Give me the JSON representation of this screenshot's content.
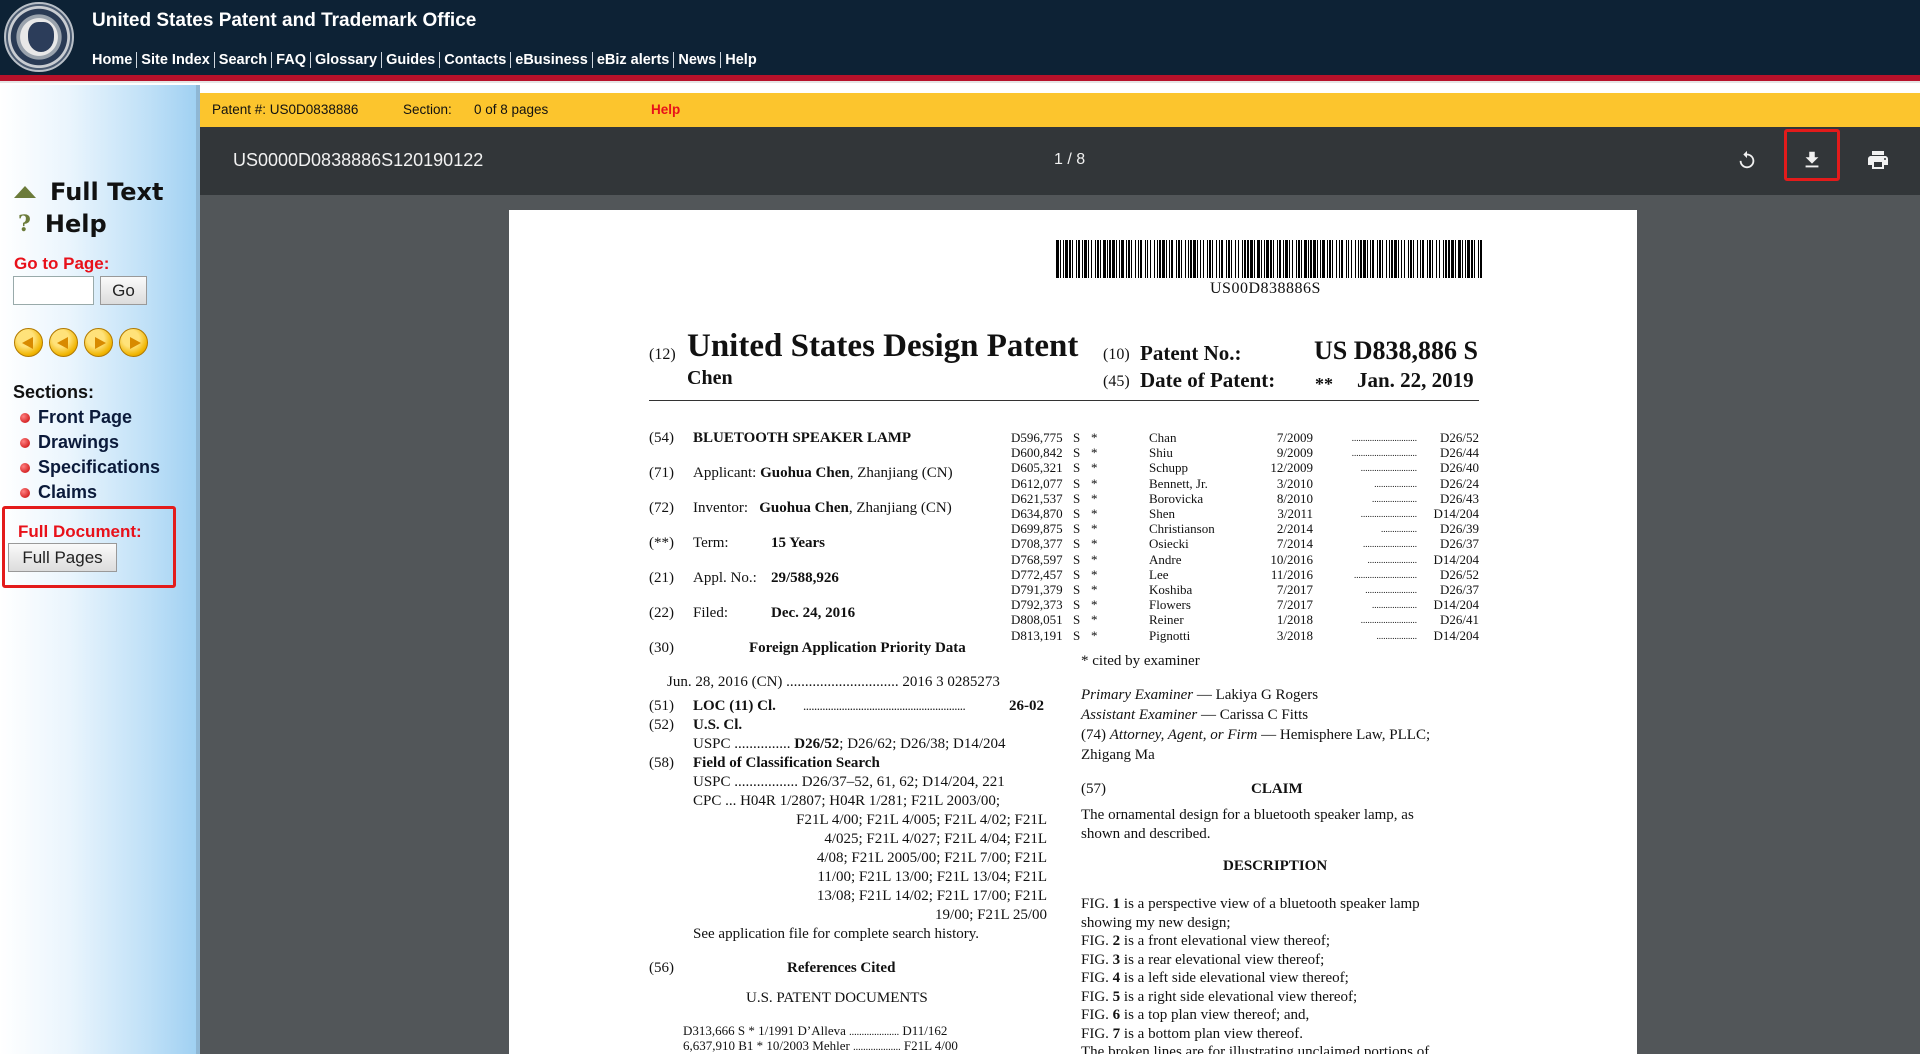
{
  "header": {
    "site_title": "United States Patent and Trademark Office",
    "nav": [
      "Home",
      "Site Index",
      "Search",
      "FAQ",
      "Glossary",
      "Guides",
      "Contacts",
      "eBusiness",
      "eBiz alerts",
      "News",
      "Help"
    ]
  },
  "sidebar": {
    "full_text": "Full Text",
    "help": "Help",
    "go_to_page_label": "Go to Page:",
    "go_to_page_value": "",
    "go_button": "Go",
    "sections_label": "Sections:",
    "sections": [
      "Front Page",
      "Drawings",
      "Specifications",
      "Claims"
    ],
    "full_document_label": "Full Document:",
    "full_pages_button": "Full Pages"
  },
  "infobar": {
    "patent_label": "Patent #: US0D0838886",
    "section_label": "Section:",
    "section_value": "0 of 8 pages",
    "help": "Help"
  },
  "viewer": {
    "doc_title": "US0000D0838886S120190122",
    "page_counter": "1 / 8",
    "icons": [
      "rotate-icon",
      "download-icon",
      "print-icon"
    ]
  },
  "document": {
    "barcode_text": "US00D838886S",
    "h12": "(12)",
    "main_title": "United States Design Patent",
    "inventor_surname": "Chen",
    "h10": "(10)",
    "patent_no_label": "Patent No.:",
    "patent_no": "US D838,886 S",
    "h45": "(45)",
    "date_label": "Date of Patent:",
    "date_stars": "**",
    "date": "Jan. 22, 2019",
    "left": {
      "f54_num": "(54)",
      "f54": "BLUETOOTH SPEAKER LAMP",
      "f71_num": "(71)",
      "f71_label": "Applicant:",
      "f71_name": "Guohua Chen",
      "f71_loc": ", Zhanjiang (CN)",
      "f72_num": "(72)",
      "f72_label": "Inventor:",
      "f72_name": "Guohua Chen",
      "f72_loc": ", Zhanjiang (CN)",
      "fterm_num": "(**)",
      "fterm_label": "Term:",
      "fterm_value": "15 Years",
      "f21_num": "(21)",
      "f21_label": "Appl. No.:",
      "f21_value": "29/588,926",
      "f22_num": "(22)",
      "f22_label": "Filed:",
      "f22_value": "Dec. 24, 2016",
      "f30_num": "(30)",
      "f30_title": "Foreign Application Priority Data",
      "f30_row": "Jun. 28, 2016    (CN) .............................. 2016 3 0285273",
      "f51_num": "(51)",
      "f51_label": "LOC (11) Cl.",
      "f51_dots": "...........................................................",
      "f51_value": "26-02",
      "f52_num": "(52)",
      "f52_label": "U.S. Cl.",
      "f52_row_a": "USPC ...............",
      "f52_row_b": "D26/52",
      "f52_row_c": "; D26/62; D26/38; D14/204",
      "f58_num": "(58)",
      "f58_title": "Field of Classification Search",
      "f58_lines": [
        "USPC ................. D26/37–52, 61, 62; D14/204, 221",
        "CPC ... H04R 1/2807; H04R 1/281; F21L 2003/00;",
        "F21L 4/00; F21L 4/005; F21L 4/02; F21L",
        "4/025; F21L 4/027; F21L 4/04; F21L",
        "4/08; F21L 2005/00; F21L 7/00; F21L",
        "11/00; F21L 13/00; F21L 13/04; F21L",
        "13/08; F21L 14/02; F21L 17/00; F21L",
        "19/00; F21L 25/00"
      ],
      "f58_note": "See application file for complete search history.",
      "f56_num": "(56)",
      "f56_title": "References Cited",
      "f56_subtitle": "U.S. PATENT DOCUMENTS",
      "refs": [
        [
          "D313,666",
          "S",
          "*",
          "1/1991",
          "D’Alleva",
          "....................",
          "D11/162"
        ],
        [
          "6,637,910",
          "B1",
          "*",
          "10/2003",
          "Mehler",
          "...................",
          "F21L 4/00"
        ]
      ]
    },
    "right": {
      "refs": [
        [
          "D596,775",
          "S",
          "*",
          "7/2009",
          "Chan",
          ".............................",
          "D26/52"
        ],
        [
          "D600,842",
          "S",
          "*",
          "9/2009",
          "Shiu",
          ".............................",
          "D26/44"
        ],
        [
          "D605,321",
          "S",
          "*",
          "12/2009",
          "Schupp",
          ".........................",
          "D26/40"
        ],
        [
          "D612,077",
          "S",
          "*",
          "3/2010",
          "Bennett, Jr.",
          "...................",
          "D26/24"
        ],
        [
          "D621,537",
          "S",
          "*",
          "8/2010",
          "Borovicka",
          "....................",
          "D26/43"
        ],
        [
          "D634,870",
          "S",
          "*",
          "3/2011",
          "Shen",
          ".........................",
          "D14/204"
        ],
        [
          "D699,875",
          "S",
          "*",
          "2/2014",
          "Christianson",
          "................",
          "D26/39"
        ],
        [
          "D708,377",
          "S",
          "*",
          "7/2014",
          "Osiecki",
          "........................",
          "D26/37"
        ],
        [
          "D768,597",
          "S",
          "*",
          "10/2016",
          "Andre",
          "......................",
          "D14/204"
        ],
        [
          "D772,457",
          "S",
          "*",
          "11/2016",
          "Lee",
          "............................",
          "D26/52"
        ],
        [
          "D791,379",
          "S",
          "*",
          "7/2017",
          "Koshiba",
          ".......................",
          "D26/37"
        ],
        [
          "D792,373",
          "S",
          "*",
          "7/2017",
          "Flowers",
          "....................",
          "D14/204"
        ],
        [
          "D808,051",
          "S",
          "*",
          "1/2018",
          "Reiner",
          ".........................",
          "D26/41"
        ],
        [
          "D813,191",
          "S",
          "*",
          "3/2018",
          "Pignotti",
          "..................",
          "D14/204"
        ]
      ],
      "cited_note": "* cited by examiner",
      "primary_label": "Primary Examiner",
      "primary_name": " — Lakiya G Rogers",
      "assistant_label": "Assistant Examiner",
      "assistant_name": " — Carissa C Fitts",
      "f74_num": "(74)",
      "f74_label": "Attorney, Agent, or Firm",
      "f74_value": " — Hemisphere Law, PLLC;",
      "f74_value2": "Zhigang Ma",
      "f57_num": "(57)",
      "claim_title": "CLAIM",
      "claim_text_1": "The ornamental design for a bluetooth speaker lamp, as",
      "claim_text_2": "shown and described.",
      "description_title": "DESCRIPTION",
      "fig_lines": [
        [
          "FIG. ",
          "1",
          " is a perspective view of a bluetooth speaker lamp"
        ],
        [
          "showing my new design;",
          "",
          ""
        ],
        [
          "FIG. ",
          "2",
          " is a front elevational view thereof;"
        ],
        [
          "FIG. ",
          "3",
          " is a rear elevational view thereof;"
        ],
        [
          "FIG. ",
          "4",
          " is a left side elevational view thereof;"
        ],
        [
          "FIG. ",
          "5",
          " is a right side elevational view thereof;"
        ],
        [
          "FIG. ",
          "6",
          " is a top plan view thereof; and,"
        ],
        [
          "FIG. ",
          "7",
          " is a bottom plan view thereof."
        ],
        [
          "The broken lines are for illustrating unclaimed portions of",
          "",
          ""
        ]
      ]
    }
  },
  "colors": {
    "header_bg": "#0d2235",
    "stripe_red": "#b7112a",
    "infobar_yellow": "#fcc52d",
    "viewer_bg": "#525659",
    "toolbar_bg": "#323639",
    "label_red": "#e8111a",
    "highlight_red": "#e31b1b"
  }
}
